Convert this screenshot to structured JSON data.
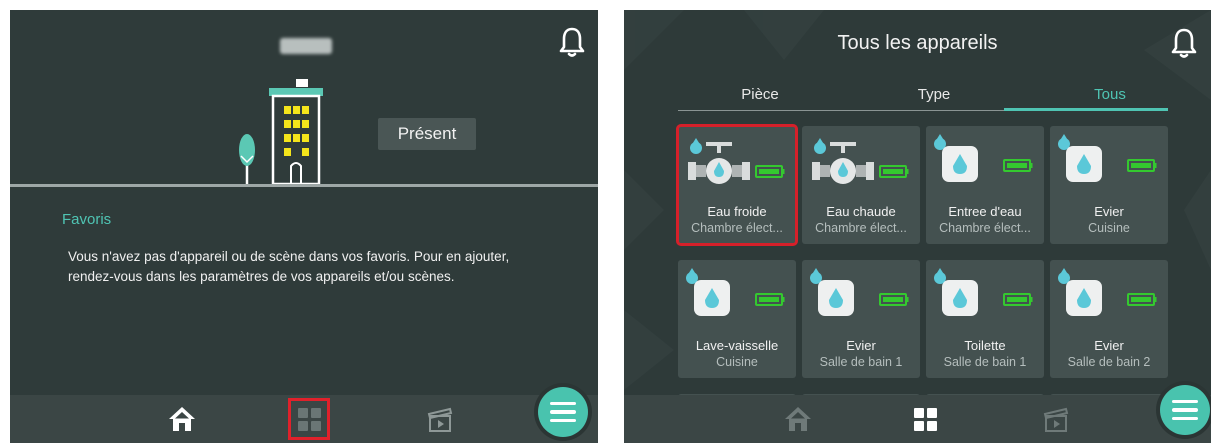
{
  "left": {
    "presence_label": "Présent",
    "favorites": {
      "title": "Favoris",
      "text": "Vous n'avez pas d'appareil ou de scène dans vos favoris. Pour en ajouter, rendez-vous dans les paramètres de vos appareils et/ou scènes."
    },
    "nav": [
      "home-icon",
      "devices-grid-icon",
      "scenes-clapper-icon"
    ]
  },
  "right": {
    "title": "Tous les appareils",
    "tabs": [
      {
        "label": "Pièce",
        "active": false
      },
      {
        "label": "Type",
        "active": false
      },
      {
        "label": "Tous",
        "active": true
      }
    ],
    "devices": [
      {
        "name": "Eau froide",
        "room": "Chambre élect...",
        "icon": "valve-icon"
      },
      {
        "name": "Eau chaude",
        "room": "Chambre élect...",
        "icon": "valve-icon"
      },
      {
        "name": "Entree d'eau",
        "room": "Chambre élect...",
        "icon": "water-drop-icon"
      },
      {
        "name": "Evier",
        "room": "Cuisine",
        "icon": "water-drop-icon"
      },
      {
        "name": "Lave-vaisselle",
        "room": "Cuisine",
        "icon": "water-drop-icon"
      },
      {
        "name": "Evier",
        "room": "Salle de bain 1",
        "icon": "water-drop-icon"
      },
      {
        "name": "Toilette",
        "room": "Salle de bain 1",
        "icon": "water-drop-icon"
      },
      {
        "name": "Evier",
        "room": "Salle de bain 2",
        "icon": "water-drop-icon"
      }
    ]
  },
  "colors": {
    "background": "#2f3b3a",
    "accent": "#4fc4b3",
    "card": "#445150",
    "battery": "#34c92f",
    "highlight": "#e0212b"
  }
}
